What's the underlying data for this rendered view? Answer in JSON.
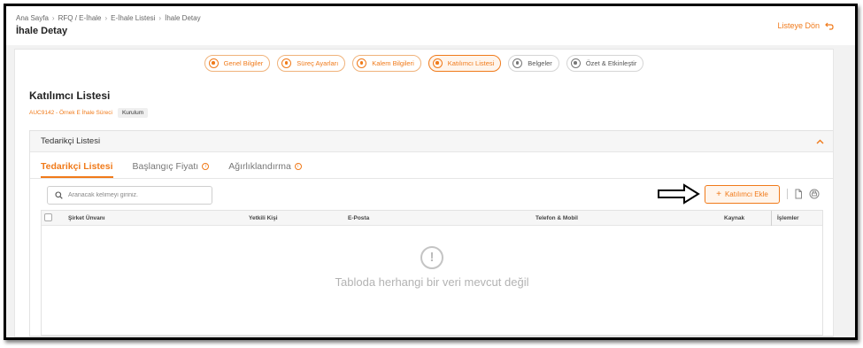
{
  "breadcrumb": [
    "Ana Sayfa",
    "RFQ / E-İhale",
    "E-İhale Listesi",
    "İhale Detay"
  ],
  "page_title": "İhale Detay",
  "back_label": "Listeye Dön",
  "steps": [
    {
      "label": "Genel Bilgiler",
      "state": "done"
    },
    {
      "label": "Süreç Ayarları",
      "state": "done"
    },
    {
      "label": "Kalem Bilgileri",
      "state": "done"
    },
    {
      "label": "Katılımcı Listesi",
      "state": "active"
    },
    {
      "label": "Belgeler",
      "state": "inactive"
    },
    {
      "label": "Özet & Etkinleştir",
      "state": "inactive"
    }
  ],
  "section": {
    "title": "Katılımcı Listesi",
    "code": "AUC9142 - Örnek E İhale Süreci",
    "status_badge": "Kurulum"
  },
  "panel": {
    "title": "Tedarikçi Listesi",
    "tabs": [
      {
        "label": "Tedarikçi Listesi",
        "active": true,
        "info": false
      },
      {
        "label": "Başlangıç Fiyatı",
        "active": false,
        "info": true
      },
      {
        "label": "Ağırlıklandırma",
        "active": false,
        "info": true
      }
    ]
  },
  "search": {
    "placeholder": "Aranacak kelimeyi giriniz."
  },
  "add_button_label": "Katılımcı Ekle",
  "table": {
    "columns": [
      "Şirket Ünvanı",
      "Yetkili Kişi",
      "E-Posta",
      "Telefon & Mobil",
      "Kaynak",
      "İşlemler"
    ]
  },
  "empty_message": "Tabloda herhangi bir veri mevcut değil",
  "colors": {
    "accent": "#f07a1a"
  }
}
